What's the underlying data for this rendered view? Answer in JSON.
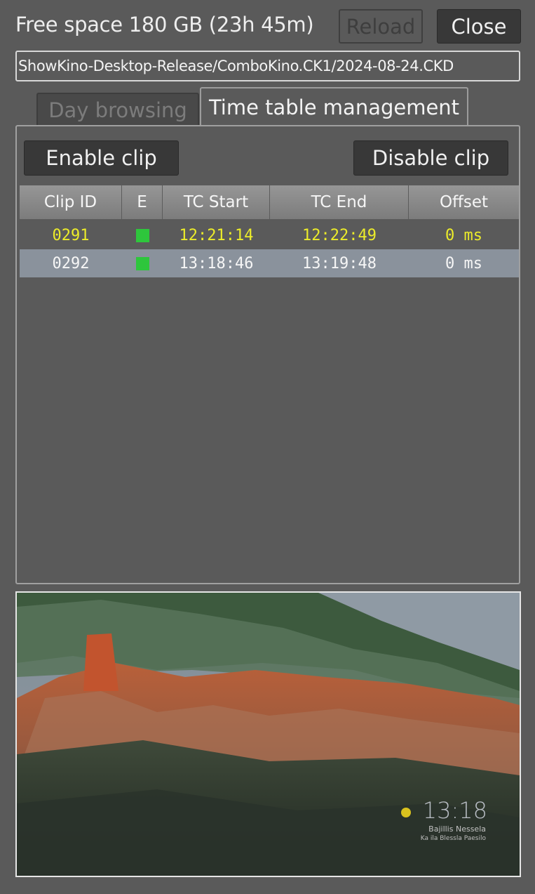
{
  "header": {
    "free_space": "Free space 180 GB (23h 45m)",
    "reload_label": "Reload",
    "close_label": "Close"
  },
  "path": "ShowKino-Desktop-Release/ComboKino.CK1/2024-08-24.CKD",
  "tabs": [
    {
      "label": "Day browsing",
      "active": false
    },
    {
      "label": "Time table management",
      "active": true
    }
  ],
  "actions": {
    "enable_label": "Enable clip",
    "disable_label": "Disable clip"
  },
  "table": {
    "columns": [
      "Clip ID",
      "E",
      "TC Start",
      "TC End",
      "Offset"
    ],
    "rows": [
      {
        "clip_id": "0291",
        "enabled": true,
        "tc_start": "12:21:14",
        "tc_end": "12:22:49",
        "offset": "0 ms",
        "state": "current"
      },
      {
        "clip_id": "0292",
        "enabled": true,
        "tc_start": "13:18:46",
        "tc_end": "13:19:48",
        "offset": "0 ms",
        "state": "selected"
      }
    ]
  },
  "preview": {
    "clock": "13:18",
    "line1": "Bajillis Nessela",
    "line2": "Ka ila Blessla Paesilo"
  },
  "colors": {
    "background": "#5a5a5a",
    "current_row_text": "#ecec2a",
    "selected_row_bg": "#8a929c",
    "enabled_indicator": "#2ec63c"
  }
}
